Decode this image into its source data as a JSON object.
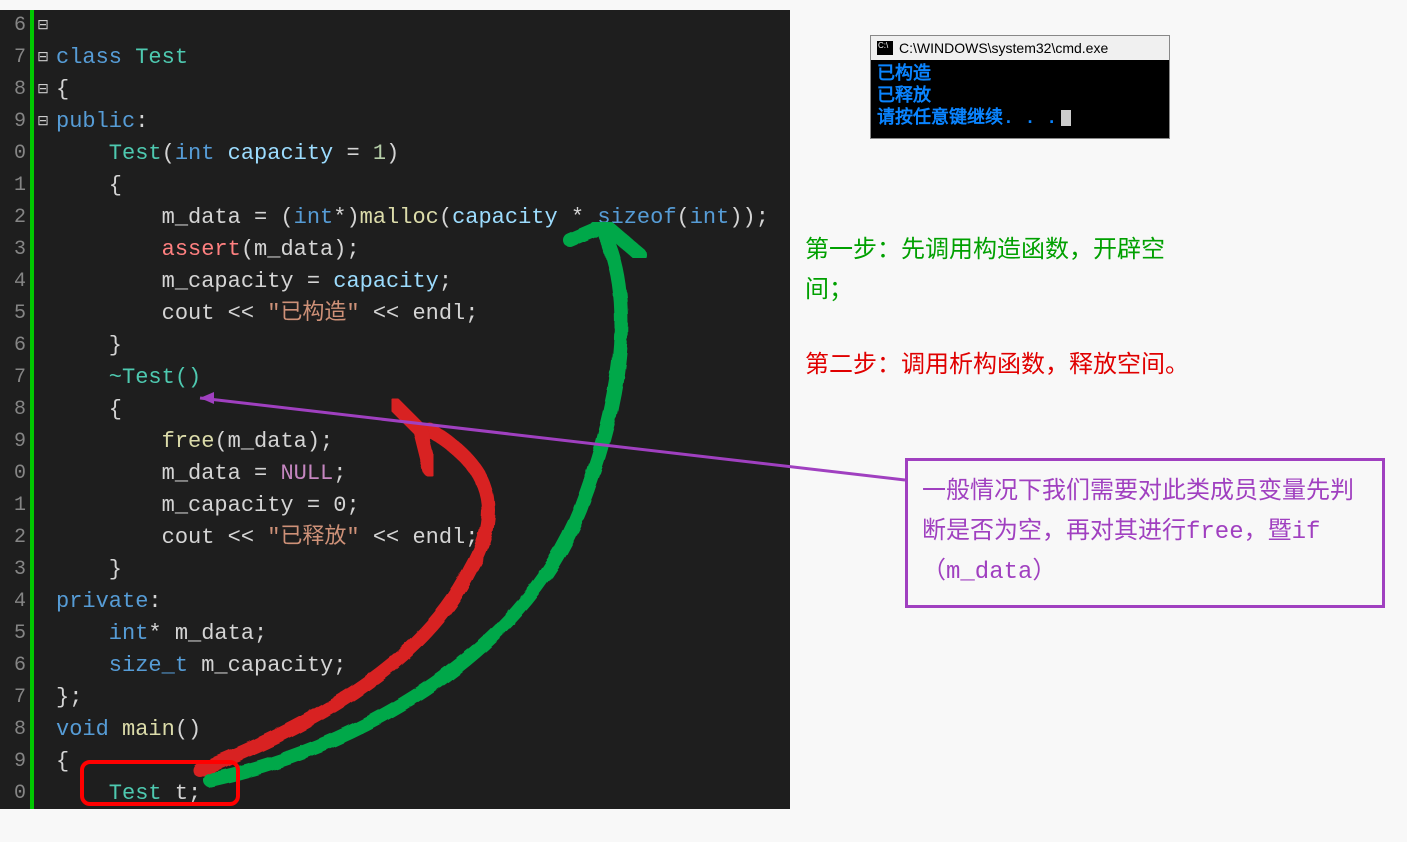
{
  "gutter": [
    "6",
    "7",
    "8",
    "9",
    "0",
    "1",
    "2",
    "3",
    "4",
    "5",
    "6",
    "7",
    "8",
    "9",
    "0",
    "1",
    "2",
    "3",
    "4",
    "5",
    "6",
    "7",
    "8",
    "9",
    "0"
  ],
  "fold": [
    "⊟",
    "",
    "",
    "⊟",
    "",
    "",
    "",
    "",
    "",
    "",
    "⊟",
    "",
    "",
    "",
    "",
    "",
    "",
    "",
    "",
    "",
    "",
    "",
    "⊟",
    "",
    ""
  ],
  "code": {
    "l0": {
      "a": "class",
      "b": " Test"
    },
    "l1": "{",
    "l2": {
      "a": "public",
      "b": ":"
    },
    "l3": {
      "a": "    Test",
      "p1": "(",
      "t1": "int ",
      "p2": "capacity",
      "eq": " = ",
      "n": "1",
      "p3": ")"
    },
    "l4": "    {",
    "l5": {
      "a": "        m_data = (",
      "t": "int",
      "b": "*)",
      "fn": "malloc",
      "p1": "(",
      "p2": "capacity",
      "m": " * ",
      "so": "sizeof",
      "p3": "(",
      "t2": "int",
      "p4": "));"
    },
    "l6": {
      "fn": "        assert",
      "p": "(m_data);"
    },
    "l7": {
      "a": "        m_capacity = ",
      "p": "capacity",
      ";": ";"
    },
    "l8": {
      "a": "        cout << ",
      "s": "\"已构造\"",
      "b": " << endl;"
    },
    "l9": "    }",
    "l10": "    ~Test()",
    "l11": "    {",
    "l12": {
      "fn": "        free",
      "p": "(m_data);"
    },
    "l13": {
      "a": "        m_data = ",
      "n": "NULL",
      ";": ";"
    },
    "l14": "        m_capacity = 0;",
    "l15": {
      "a": "        cout << ",
      "s": "\"已释放\"",
      "b": " << endl;"
    },
    "l16": "    }",
    "l17": {
      "a": "private",
      "b": ":"
    },
    "l18": {
      "t": "    int",
      "b": "* m_data;"
    },
    "l19": {
      "t": "    size_t",
      "b": " m_capacity;"
    },
    "l20": "};",
    "l21": {
      "t": "void ",
      "fn": "main",
      "p": "()"
    },
    "l22": "{",
    "l23": {
      "t": "    Test ",
      "v": "t;"
    }
  },
  "console": {
    "title": "C:\\WINDOWS\\system32\\cmd.exe",
    "line1": "已构造",
    "line2": "已释放",
    "line3": "请按任意键继续. . ."
  },
  "annotations": {
    "step1": "第一步：先调用构造函数，开辟空间；",
    "step2": "第二步：调用析构函数，释放空间。",
    "note": "一般情况下我们需要对此类成员变量先判断是否为空，再对其进行free，暨if（m_data）"
  }
}
